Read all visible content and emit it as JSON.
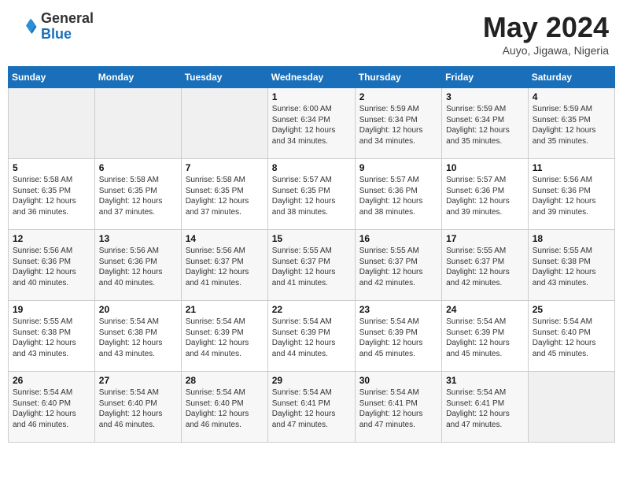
{
  "header": {
    "logo_general": "General",
    "logo_blue": "Blue",
    "title": "May 2024",
    "location": "Auyo, Jigawa, Nigeria"
  },
  "weekdays": [
    "Sunday",
    "Monday",
    "Tuesday",
    "Wednesday",
    "Thursday",
    "Friday",
    "Saturday"
  ],
  "weeks": [
    [
      {
        "day": "",
        "info": ""
      },
      {
        "day": "",
        "info": ""
      },
      {
        "day": "",
        "info": ""
      },
      {
        "day": "1",
        "info": "Sunrise: 6:00 AM\nSunset: 6:34 PM\nDaylight: 12 hours\nand 34 minutes."
      },
      {
        "day": "2",
        "info": "Sunrise: 5:59 AM\nSunset: 6:34 PM\nDaylight: 12 hours\nand 34 minutes."
      },
      {
        "day": "3",
        "info": "Sunrise: 5:59 AM\nSunset: 6:34 PM\nDaylight: 12 hours\nand 35 minutes."
      },
      {
        "day": "4",
        "info": "Sunrise: 5:59 AM\nSunset: 6:35 PM\nDaylight: 12 hours\nand 35 minutes."
      }
    ],
    [
      {
        "day": "5",
        "info": "Sunrise: 5:58 AM\nSunset: 6:35 PM\nDaylight: 12 hours\nand 36 minutes."
      },
      {
        "day": "6",
        "info": "Sunrise: 5:58 AM\nSunset: 6:35 PM\nDaylight: 12 hours\nand 37 minutes."
      },
      {
        "day": "7",
        "info": "Sunrise: 5:58 AM\nSunset: 6:35 PM\nDaylight: 12 hours\nand 37 minutes."
      },
      {
        "day": "8",
        "info": "Sunrise: 5:57 AM\nSunset: 6:35 PM\nDaylight: 12 hours\nand 38 minutes."
      },
      {
        "day": "9",
        "info": "Sunrise: 5:57 AM\nSunset: 6:36 PM\nDaylight: 12 hours\nand 38 minutes."
      },
      {
        "day": "10",
        "info": "Sunrise: 5:57 AM\nSunset: 6:36 PM\nDaylight: 12 hours\nand 39 minutes."
      },
      {
        "day": "11",
        "info": "Sunrise: 5:56 AM\nSunset: 6:36 PM\nDaylight: 12 hours\nand 39 minutes."
      }
    ],
    [
      {
        "day": "12",
        "info": "Sunrise: 5:56 AM\nSunset: 6:36 PM\nDaylight: 12 hours\nand 40 minutes."
      },
      {
        "day": "13",
        "info": "Sunrise: 5:56 AM\nSunset: 6:36 PM\nDaylight: 12 hours\nand 40 minutes."
      },
      {
        "day": "14",
        "info": "Sunrise: 5:56 AM\nSunset: 6:37 PM\nDaylight: 12 hours\nand 41 minutes."
      },
      {
        "day": "15",
        "info": "Sunrise: 5:55 AM\nSunset: 6:37 PM\nDaylight: 12 hours\nand 41 minutes."
      },
      {
        "day": "16",
        "info": "Sunrise: 5:55 AM\nSunset: 6:37 PM\nDaylight: 12 hours\nand 42 minutes."
      },
      {
        "day": "17",
        "info": "Sunrise: 5:55 AM\nSunset: 6:37 PM\nDaylight: 12 hours\nand 42 minutes."
      },
      {
        "day": "18",
        "info": "Sunrise: 5:55 AM\nSunset: 6:38 PM\nDaylight: 12 hours\nand 43 minutes."
      }
    ],
    [
      {
        "day": "19",
        "info": "Sunrise: 5:55 AM\nSunset: 6:38 PM\nDaylight: 12 hours\nand 43 minutes."
      },
      {
        "day": "20",
        "info": "Sunrise: 5:54 AM\nSunset: 6:38 PM\nDaylight: 12 hours\nand 43 minutes."
      },
      {
        "day": "21",
        "info": "Sunrise: 5:54 AM\nSunset: 6:39 PM\nDaylight: 12 hours\nand 44 minutes."
      },
      {
        "day": "22",
        "info": "Sunrise: 5:54 AM\nSunset: 6:39 PM\nDaylight: 12 hours\nand 44 minutes."
      },
      {
        "day": "23",
        "info": "Sunrise: 5:54 AM\nSunset: 6:39 PM\nDaylight: 12 hours\nand 45 minutes."
      },
      {
        "day": "24",
        "info": "Sunrise: 5:54 AM\nSunset: 6:39 PM\nDaylight: 12 hours\nand 45 minutes."
      },
      {
        "day": "25",
        "info": "Sunrise: 5:54 AM\nSunset: 6:40 PM\nDaylight: 12 hours\nand 45 minutes."
      }
    ],
    [
      {
        "day": "26",
        "info": "Sunrise: 5:54 AM\nSunset: 6:40 PM\nDaylight: 12 hours\nand 46 minutes."
      },
      {
        "day": "27",
        "info": "Sunrise: 5:54 AM\nSunset: 6:40 PM\nDaylight: 12 hours\nand 46 minutes."
      },
      {
        "day": "28",
        "info": "Sunrise: 5:54 AM\nSunset: 6:40 PM\nDaylight: 12 hours\nand 46 minutes."
      },
      {
        "day": "29",
        "info": "Sunrise: 5:54 AM\nSunset: 6:41 PM\nDaylight: 12 hours\nand 47 minutes."
      },
      {
        "day": "30",
        "info": "Sunrise: 5:54 AM\nSunset: 6:41 PM\nDaylight: 12 hours\nand 47 minutes."
      },
      {
        "day": "31",
        "info": "Sunrise: 5:54 AM\nSunset: 6:41 PM\nDaylight: 12 hours\nand 47 minutes."
      },
      {
        "day": "",
        "info": ""
      }
    ]
  ]
}
